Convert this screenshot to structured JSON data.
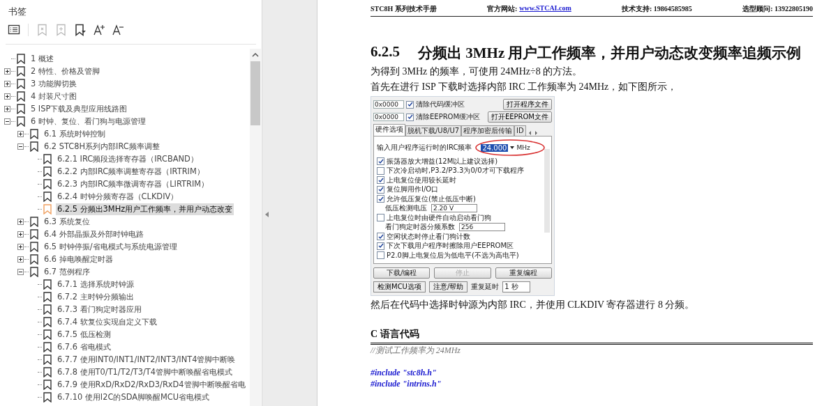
{
  "sidebar": {
    "title": "书签",
    "toolbar": [
      {
        "kind": "list",
        "disabled": false
      },
      {
        "kind": "bookmark-remove",
        "disabled": true
      },
      {
        "kind": "bookmark-add",
        "disabled": true
      },
      {
        "kind": "bookmark-menu",
        "disabled": false
      },
      {
        "kind": "font-larger",
        "disabled": false
      },
      {
        "kind": "font-smaller",
        "disabled": false
      }
    ],
    "bookmarks": [
      {
        "label": "1 概述",
        "selected": false
      },
      {
        "label": "2 特性、价格及管脚",
        "selected": false,
        "expanded": false
      },
      {
        "label": "3 功能脚切换",
        "selected": false,
        "expanded": false
      },
      {
        "label": "4 封装尺寸图",
        "selected": false,
        "expanded": false
      },
      {
        "label": "5 ISP下载及典型应用线路图",
        "selected": false,
        "expanded": false
      },
      {
        "label": "6 时钟、复位、看门狗与电源管理",
        "selected": false,
        "expanded": true,
        "children": [
          {
            "label": "6.1 系统时钟控制",
            "selected": false,
            "expanded": false
          },
          {
            "label": "6.2 STC8H系列内部IRC频率调整",
            "selected": false,
            "expanded": true,
            "children": [
              {
                "label": "6.2.1 IRC频段选择寄存器（IRCBAND）",
                "selected": false
              },
              {
                "label": "6.2.2 内部IRC频率调整寄存器（IRTRIM）",
                "selected": false
              },
              {
                "label": "6.2.3 内部IRC频率微调寄存器（LIRTRIM）",
                "selected": false
              },
              {
                "label": "6.2.4 时钟分频寄存器（CLKDIV）",
                "selected": false
              },
              {
                "label": "6.2.5 分频出3MHz用户工作频率，并用户动态改变",
                "selected": true
              }
            ]
          },
          {
            "label": "6.3 系统复位",
            "selected": false,
            "expanded": false
          },
          {
            "label": "6.4 外部晶振及外部时钟电路",
            "selected": false,
            "expanded": false
          },
          {
            "label": "6.5 时钟停振/省电模式与系统电源管理",
            "selected": false,
            "expanded": false
          },
          {
            "label": "6.6 掉电唤醒定时器",
            "selected": false,
            "expanded": false
          },
          {
            "label": "6.7 范例程序",
            "selected": false,
            "expanded": true,
            "children": [
              {
                "label": "6.7.1 选择系统时钟源",
                "selected": false
              },
              {
                "label": "6.7.2 主时钟分频输出",
                "selected": false
              },
              {
                "label": "6.7.3 看门狗定时器应用",
                "selected": false
              },
              {
                "label": "6.7.4 软复位实现自定义下载",
                "selected": false
              },
              {
                "label": "6.7.5 低压检测",
                "selected": false
              },
              {
                "label": "6.7.6 省电模式",
                "selected": false
              },
              {
                "label": "6.7.7 使用INT0/INT1/INT2/INT3/INT4管脚中断唤",
                "selected": false
              },
              {
                "label": "6.7.8 使用T0/T1/T2/T3/T4管脚中断唤醒省电模式",
                "selected": false
              },
              {
                "label": "6.7.9 使用RxD/RxD2/RxD3/RxD4管脚中断唤醒省电",
                "selected": false
              },
              {
                "label": "6.7.10 使用I2C的SDA脚唤醒MCU省电模式",
                "selected": false
              }
            ]
          }
        ]
      }
    ]
  },
  "document": {
    "header": {
      "title": "STC8H 系列技术手册",
      "site_label": "官方网站:",
      "site_link": "www.STCAI.com",
      "support": "技术支持: 19864585985",
      "advisor": "选型顾问: 13922805190"
    },
    "heading": {
      "number": "6.2.5",
      "title": "分频出 3MHz 用户工作频率，并用户动态改变频率追频示例"
    },
    "intro": [
      "为得到 3MHz 的频率，可使用 24MHz÷8 的方法。",
      "首先在进行 ISP 下载时选择内部 IRC 工作频率为 24MHz，如下图所示，"
    ],
    "dialog": {
      "buffers": [
        {
          "address": "0x0000",
          "checked": true,
          "label": "清除代码缓冲区",
          "button": "打开程序文件"
        },
        {
          "address": "0x0000",
          "checked": true,
          "label": "清除EEPROM缓冲区",
          "button": "打开EEPROM文件"
        }
      ],
      "tabs": [
        {
          "label": "硬件选项",
          "selected": true
        },
        {
          "label": "脱机下载/U8/U7",
          "selected": false
        },
        {
          "label": "程序加密后传输",
          "selected": false
        },
        {
          "label": "ID",
          "selected": false
        }
      ],
      "frequency": {
        "label": "输入用户程序运行时的IRC频率",
        "value": "24.000",
        "unit": "MHz"
      },
      "options": [
        {
          "kind": "checkbox",
          "label": "振荡器放大增益(12M以上建议选择)",
          "checked": true
        },
        {
          "kind": "checkbox",
          "label": "下次冷启动时,P3.2/P3.3为0/0才可下载程序",
          "checked": false
        },
        {
          "kind": "checkbox",
          "label": "上电复位使用较长延时",
          "checked": true
        },
        {
          "kind": "checkbox",
          "label": "复位脚用作I/O口",
          "checked": true
        },
        {
          "kind": "checkbox",
          "label": "允许低压复位(禁止低压中断)",
          "checked": true
        },
        {
          "kind": "select",
          "label": "低压检测电压",
          "value": "2.20 V"
        },
        {
          "kind": "checkbox",
          "label": "上电复位时由硬件自动启动看门狗",
          "checked": false
        },
        {
          "kind": "select",
          "label": "看门狗定时器分频系数",
          "value": "256"
        },
        {
          "kind": "checkbox",
          "label": "空闲状态时停止看门狗计数",
          "checked": true
        },
        {
          "kind": "checkbox",
          "label": "下次下载用户程序时擦除用户EEPROM区",
          "checked": true
        },
        {
          "kind": "checkbox",
          "label": "P2.0脚上电复位后为低电平(不选为高电平)",
          "checked": false
        }
      ],
      "buttons": [
        {
          "label": "下载/编程",
          "disabled": false
        },
        {
          "label": "停止",
          "disabled": true
        },
        {
          "label": "重复编程",
          "disabled": false
        }
      ],
      "footer": {
        "buttons": [
          "检测MCU选项",
          "注意/帮助"
        ],
        "label": "重复延时",
        "value": "1 秒"
      }
    },
    "after": "然后在代码中选择时钟源为内部 IRC，并使用 CLKDIV 寄存器进行 8 分频。",
    "code_title": "C 语言代码",
    "code": [
      {
        "kind": "comment",
        "text": "//测试工作频率为 24MHz"
      },
      {
        "kind": "blank"
      },
      {
        "kind": "directive",
        "text": "#include \"stc8h.h\""
      },
      {
        "kind": "directive",
        "text": "#include \"intrins.h\""
      }
    ]
  }
}
